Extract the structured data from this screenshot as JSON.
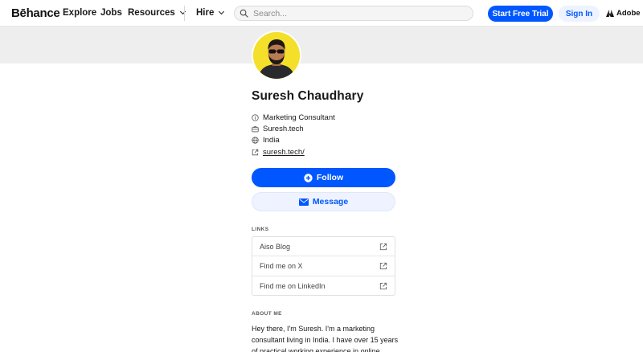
{
  "header": {
    "logo": "Bēhance",
    "nav": {
      "explore": "Explore",
      "jobs": "Jobs",
      "resources": "Resources",
      "hire": "Hire"
    },
    "search_placeholder": "Search...",
    "trial_label": "Start Free Trial",
    "signin_label": "Sign In",
    "adobe_label": "Adobe"
  },
  "profile": {
    "name": "Suresh Chaudhary",
    "occupation": "Marketing Consultant",
    "company": "Suresh.tech",
    "location": "India",
    "website": "suresh.tech/",
    "follow_label": "Follow",
    "message_label": "Message"
  },
  "links": {
    "title": "LINKS",
    "items": [
      "Aiso Blog",
      "Find me on X",
      "Find me on LinkedIn"
    ]
  },
  "about": {
    "title": "ABOUT ME",
    "text": "Hey there, I'm Suresh. I'm a marketing consultant living in India. I have over 15 years of practical working experience in online"
  },
  "colors": {
    "accent": "#0057ff",
    "avatar_bg": "#f4e02a",
    "banner": "#eeeeee"
  }
}
